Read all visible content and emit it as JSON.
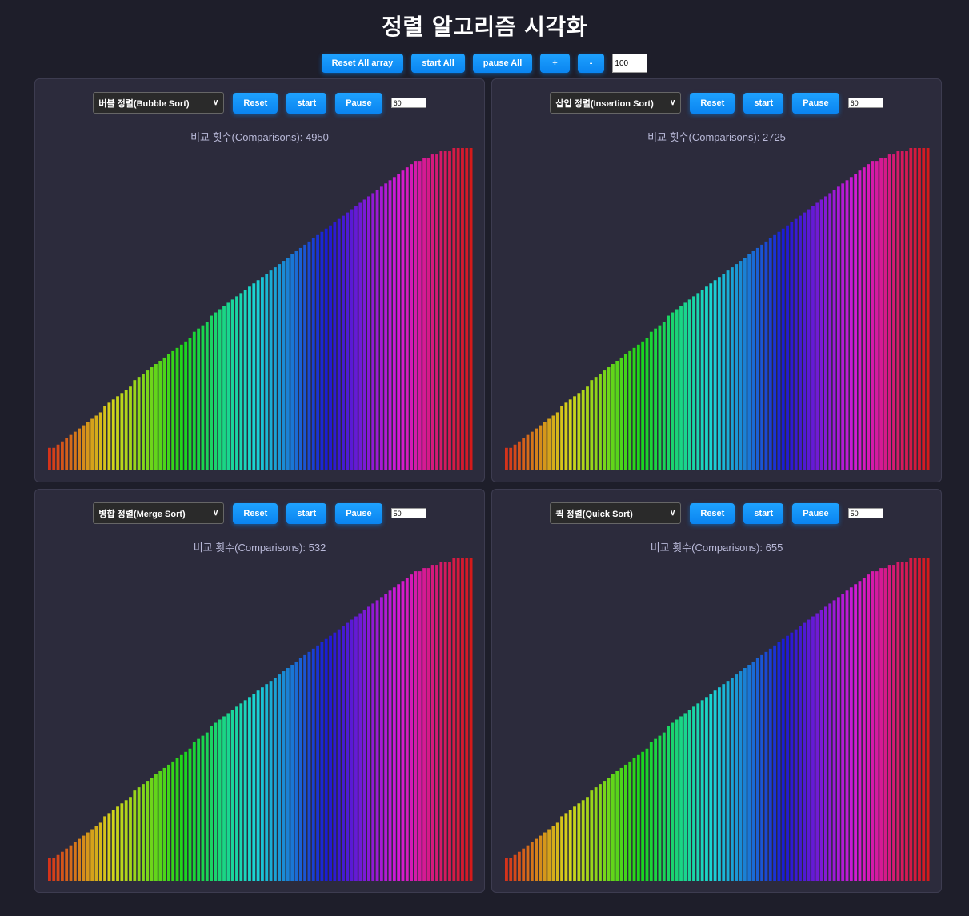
{
  "page": {
    "title": "정렬 알고리즘 시각화"
  },
  "global_controls": {
    "reset_all_label": "Reset All array",
    "start_all_label": "start All",
    "pause_all_label": "pause All",
    "plus_label": "+",
    "minus_label": "-",
    "array_size_value": "100"
  },
  "panels": [
    {
      "algorithm": "버블 정렬(Bubble Sort)",
      "reset_label": "Reset",
      "start_label": "start",
      "pause_label": "Pause",
      "speed_value": "60",
      "comparisons_text": "비교 횟수(Comparisons): 4950"
    },
    {
      "algorithm": "삽입 정렬(Insertion Sort)",
      "reset_label": "Reset",
      "start_label": "start",
      "pause_label": "Pause",
      "speed_value": "60",
      "comparisons_text": "비교 횟수(Comparisons): 2725"
    },
    {
      "algorithm": "병합 정렬(Merge Sort)",
      "reset_label": "Reset",
      "start_label": "start",
      "pause_label": "Pause",
      "speed_value": "50",
      "comparisons_text": "비교 횟수(Comparisons): 532"
    },
    {
      "algorithm": "퀵 정렬(Quick Sort)",
      "reset_label": "Reset",
      "start_label": "start",
      "pause_label": "Pause",
      "speed_value": "50",
      "comparisons_text": "비교 횟수(Comparisons): 655"
    }
  ],
  "icons": {
    "dropdown": "chevron-down-icon"
  },
  "colors": {
    "background": "#1e1e2a",
    "panel": "#2c2b3c",
    "button": "#0a84f0",
    "comparison_text": "#b9b9d8"
  },
  "chart_data": [
    {
      "type": "bar",
      "panel": "버블 정렬(Bubble Sort)",
      "bar_count": 100,
      "values": [
        7,
        7,
        8,
        9,
        10,
        11,
        12,
        13,
        14,
        15,
        16,
        17,
        18,
        20,
        21,
        22,
        23,
        24,
        25,
        26,
        28,
        29,
        30,
        31,
        32,
        33,
        34,
        35,
        36,
        37,
        38,
        39,
        40,
        41,
        43,
        44,
        45,
        46,
        48,
        49,
        50,
        51,
        52,
        53,
        54,
        55,
        56,
        57,
        58,
        59,
        60,
        61,
        62,
        63,
        64,
        65,
        66,
        67,
        68,
        69,
        70,
        71,
        72,
        73,
        74,
        75,
        76,
        77,
        78,
        79,
        80,
        81,
        82,
        83,
        84,
        85,
        86,
        87,
        88,
        89,
        90,
        91,
        92,
        93,
        94,
        95,
        96,
        96,
        97,
        97,
        98,
        98,
        99,
        99,
        99,
        100,
        100,
        100,
        100,
        100
      ],
      "ylim": [
        0,
        100
      ]
    },
    {
      "type": "bar",
      "panel": "삽입 정렬(Insertion Sort)",
      "bar_count": 100,
      "values": [
        7,
        7,
        8,
        9,
        10,
        11,
        12,
        13,
        14,
        15,
        16,
        17,
        18,
        20,
        21,
        22,
        23,
        24,
        25,
        26,
        28,
        29,
        30,
        31,
        32,
        33,
        34,
        35,
        36,
        37,
        38,
        39,
        40,
        41,
        43,
        44,
        45,
        46,
        48,
        49,
        50,
        51,
        52,
        53,
        54,
        55,
        56,
        57,
        58,
        59,
        60,
        61,
        62,
        63,
        64,
        65,
        66,
        67,
        68,
        69,
        70,
        71,
        72,
        73,
        74,
        75,
        76,
        77,
        78,
        79,
        80,
        81,
        82,
        83,
        84,
        85,
        86,
        87,
        88,
        89,
        90,
        91,
        92,
        93,
        94,
        95,
        96,
        96,
        97,
        97,
        98,
        98,
        99,
        99,
        99,
        100,
        100,
        100,
        100,
        100
      ],
      "ylim": [
        0,
        100
      ]
    },
    {
      "type": "bar",
      "panel": "병합 정렬(Merge Sort)",
      "bar_count": 100,
      "values": [
        7,
        7,
        8,
        9,
        10,
        11,
        12,
        13,
        14,
        15,
        16,
        17,
        18,
        20,
        21,
        22,
        23,
        24,
        25,
        26,
        28,
        29,
        30,
        31,
        32,
        33,
        34,
        35,
        36,
        37,
        38,
        39,
        40,
        41,
        43,
        44,
        45,
        46,
        48,
        49,
        50,
        51,
        52,
        53,
        54,
        55,
        56,
        57,
        58,
        59,
        60,
        61,
        62,
        63,
        64,
        65,
        66,
        67,
        68,
        69,
        70,
        71,
        72,
        73,
        74,
        75,
        76,
        77,
        78,
        79,
        80,
        81,
        82,
        83,
        84,
        85,
        86,
        87,
        88,
        89,
        90,
        91,
        92,
        93,
        94,
        95,
        96,
        96,
        97,
        97,
        98,
        98,
        99,
        99,
        99,
        100,
        100,
        100,
        100,
        100
      ],
      "ylim": [
        0,
        100
      ]
    },
    {
      "type": "bar",
      "panel": "퀵 정렬(Quick Sort)",
      "bar_count": 100,
      "values": [
        7,
        7,
        8,
        9,
        10,
        11,
        12,
        13,
        14,
        15,
        16,
        17,
        18,
        20,
        21,
        22,
        23,
        24,
        25,
        26,
        28,
        29,
        30,
        31,
        32,
        33,
        34,
        35,
        36,
        37,
        38,
        39,
        40,
        41,
        43,
        44,
        45,
        46,
        48,
        49,
        50,
        51,
        52,
        53,
        54,
        55,
        56,
        57,
        58,
        59,
        60,
        61,
        62,
        63,
        64,
        65,
        66,
        67,
        68,
        69,
        70,
        71,
        72,
        73,
        74,
        75,
        76,
        77,
        78,
        79,
        80,
        81,
        82,
        83,
        84,
        85,
        86,
        87,
        88,
        89,
        90,
        91,
        92,
        93,
        94,
        95,
        96,
        96,
        97,
        97,
        98,
        98,
        99,
        99,
        99,
        100,
        100,
        100,
        100,
        100
      ],
      "ylim": [
        0,
        100
      ]
    }
  ]
}
